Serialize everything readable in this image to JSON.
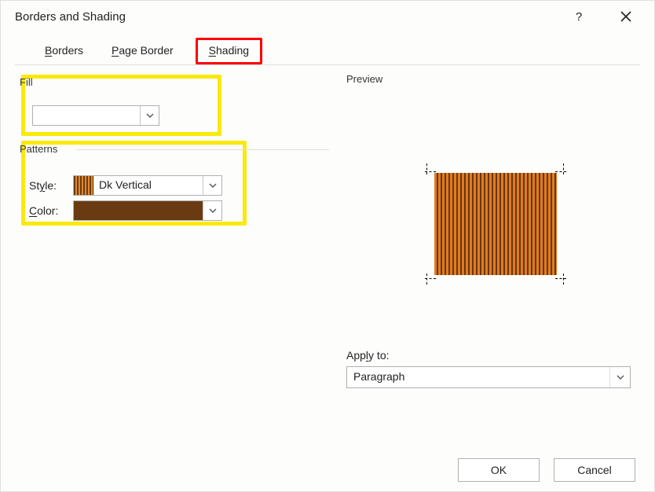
{
  "dialog": {
    "title": "Borders and Shading",
    "help_tooltip": "?",
    "close_tooltip": "Close"
  },
  "tabs": {
    "borders": "Borders",
    "page_border": "Page Border",
    "shading": "Shading",
    "active": "shading",
    "highlighted_by_annotation": "shading"
  },
  "fill": {
    "label": "Fill",
    "color_hex": "#e28a2b"
  },
  "patterns": {
    "label": "Patterns",
    "style_label": "Style:",
    "style_value": "Dk Vertical",
    "color_label": "Color:",
    "color_hex": "#6a3b12"
  },
  "preview": {
    "label": "Preview"
  },
  "apply_to": {
    "label": "Apply to:",
    "value": "Paragraph"
  },
  "buttons": {
    "ok": "OK",
    "cancel": "Cancel"
  },
  "annotations": {
    "red_box_around_tab": "Shading",
    "yellow_box_fill_section": true,
    "yellow_box_patterns_section": true
  }
}
